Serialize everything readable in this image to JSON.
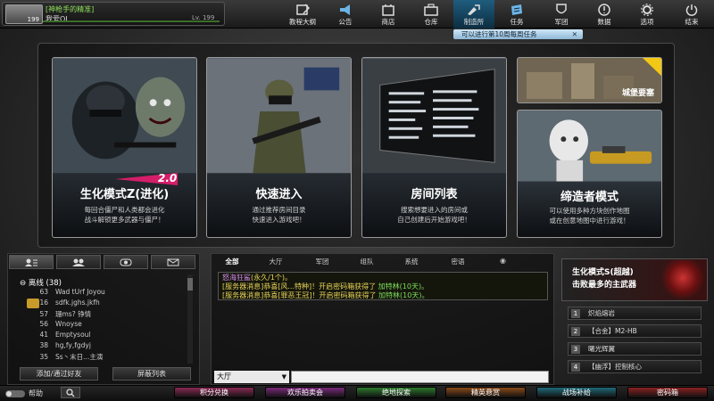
{
  "profile": {
    "tag": "[神枪手的精准]",
    "name": "我爱OL",
    "level": "Lv. 199",
    "avatar_level": "199"
  },
  "nav": [
    {
      "label": "教程大纲",
      "icon": "tutorial-icon"
    },
    {
      "label": "公告",
      "icon": "megaphone-icon"
    },
    {
      "label": "商店",
      "icon": "shop-icon"
    },
    {
      "label": "仓库",
      "icon": "warehouse-icon"
    },
    {
      "label": "制造所",
      "icon": "crafting-icon"
    },
    {
      "label": "任务",
      "icon": "mission-icon"
    },
    {
      "label": "军团",
      "icon": "clan-icon"
    },
    {
      "label": "数据",
      "icon": "data-icon"
    },
    {
      "label": "选项",
      "icon": "gear-icon"
    },
    {
      "label": "结束",
      "icon": "power-icon"
    }
  ],
  "mission_hint": "可以进行第10周每周任务",
  "modes": {
    "zombie": {
      "badge": "2.0",
      "title": "生化模式Z(进化)",
      "desc1": "每回合僵尸和人类都会进化",
      "desc2": "战斗解锁更多武器与僵尸！"
    },
    "quick": {
      "title": "快速进入",
      "desc1": "通过推荐房间目录",
      "desc2": "快速进入游戏吧！"
    },
    "rooms": {
      "title": "房间列表",
      "desc1": "搜索想要进入的房间或",
      "desc2": "自己创建后开始游戏吧！"
    },
    "castle": {
      "label": "城堡要塞"
    },
    "shrink": {
      "title": "缔造者模式",
      "desc1": "可以使用多种方块创作地图",
      "desc2": "或在创意地图中进行游戏！"
    }
  },
  "friends": {
    "group_label": "离线",
    "group_count": "(38)",
    "rows": [
      {
        "level": "63",
        "name": "Wad  tUrf  Joyou"
      },
      {
        "level": "16",
        "name": "sdfk.jghs.jkfh"
      },
      {
        "level": "57",
        "name": "珊ms?   铮情"
      },
      {
        "level": "56",
        "name": "Wnoyse"
      },
      {
        "level": "41",
        "name": "Emptysoul"
      },
      {
        "level": "38",
        "name": "hg,fy,fgdyj"
      },
      {
        "level": "35",
        "name": "Ss丶末日...主演"
      }
    ],
    "add_button": "添加/通过好友",
    "block_button": "屏蔽列表"
  },
  "chat": {
    "tabs": [
      "全部",
      "大厅",
      "军团",
      "组队",
      "系统",
      "密语"
    ],
    "lines": [
      {
        "speaker": "怒海狂鲨",
        "text": "(永久/1个)。",
        "item": ""
      },
      {
        "speaker": "[服务器消息]",
        "text": "恭喜[风...特种]！开启密码箱获得了",
        "item": "加特林(10天)。"
      },
      {
        "speaker": "[服务器消息]",
        "text": "恭喜[罪恶王冠]！开启密码箱获得了",
        "item": "加特林(10天)。"
      }
    ],
    "channel": "大厅"
  },
  "event": {
    "line1": "生化模式S(超越)",
    "line2": "击败最多的主武器",
    "items": [
      {
        "num": "1",
        "label": "炽焰熔岩"
      },
      {
        "num": "2",
        "label": "【合金】M2-HB"
      },
      {
        "num": "3",
        "label": "曙光辉翼"
      },
      {
        "num": "4",
        "label": "【幽浮】控制核心"
      }
    ]
  },
  "bottom": {
    "help": "帮助",
    "buttons": [
      {
        "label": "积分兑换",
        "color": "#8a2a55"
      },
      {
        "label": "欢乐拍卖会",
        "color": "#7a2a7a"
      },
      {
        "label": "绝地探索",
        "color": "#2c7a2c"
      },
      {
        "label": "精英悬赏",
        "color": "#8a4a18"
      },
      {
        "label": "战场补给",
        "color": "#1f6a7a"
      },
      {
        "label": "密码箱",
        "color": "#8a2222"
      }
    ]
  }
}
